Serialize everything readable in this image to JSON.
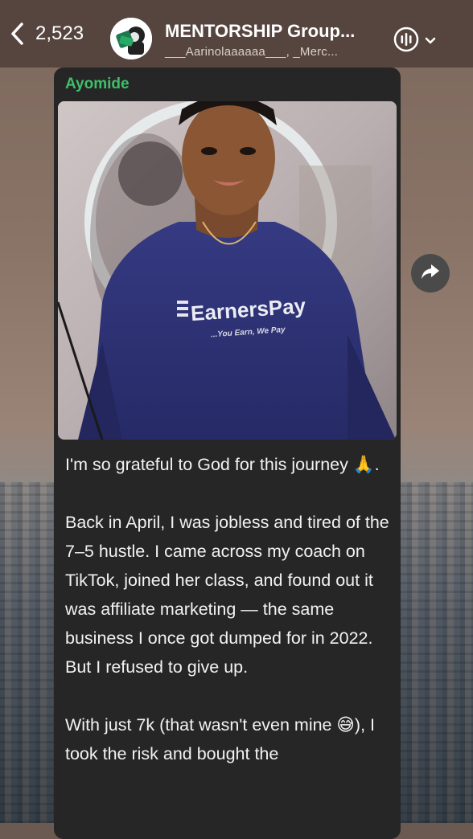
{
  "header": {
    "back_count": "2,523",
    "title": "MENTORSHIP Group...",
    "subtitle": "___Aarinolaaaaaa___, _Merc...",
    "icons": [
      "chevron-left-icon",
      "group-avatar",
      "voice-call-icon",
      "chevron-down-icon"
    ]
  },
  "message": {
    "sender": "Ayomide",
    "sender_color": "#3fbf6a",
    "shirt_brand": "EarnersPay",
    "shirt_tagline": "...You Earn, We Pay",
    "text": "I'm so grateful to God for this journey 🙏.\n\nBack in April, I was jobless and tired of the 7–5 hustle. I came across my coach on TikTok, joined her class, and found out it was affiliate marketing — the same business I once got dumped for in 2022. But I refused to give up.\n\nWith just 7k (that wasn't even mine 😅), I took the risk and bought the"
  },
  "forward_icon": "forward-arrow-icon",
  "colors": {
    "header_bg": "#56453f",
    "bubble_bg": "#262626",
    "text": "#f2f2f2"
  }
}
